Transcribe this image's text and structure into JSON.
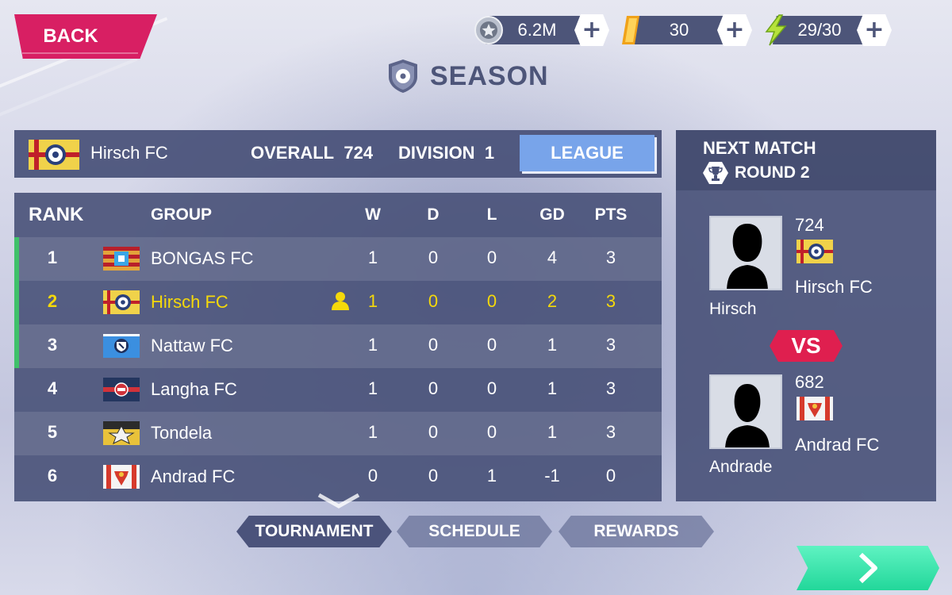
{
  "header": {
    "back_label": "BACK",
    "title": "SEASON",
    "currencies": [
      {
        "icon": "silver-coin-icon",
        "value": "6.2M"
      },
      {
        "icon": "gold-bar-icon",
        "value": "30"
      },
      {
        "icon": "lightning-energy-icon",
        "value": "29/30"
      }
    ],
    "plus_label": "+"
  },
  "team": {
    "name": "Hirsch FC",
    "overall_label": "OVERALL",
    "overall_value": "724",
    "division_label": "DIVISION",
    "division_value": "1",
    "league_button": "LEAGUE"
  },
  "standings": {
    "columns": [
      "RANK",
      "GROUP",
      "W",
      "D",
      "L",
      "GD",
      "PTS"
    ],
    "rows": [
      {
        "rank": "1",
        "name": "BONGAS FC",
        "w": "1",
        "d": "0",
        "l": "0",
        "gd": "4",
        "pts": "3"
      },
      {
        "rank": "2",
        "name": "Hirsch FC",
        "w": "1",
        "d": "0",
        "l": "0",
        "gd": "2",
        "pts": "3"
      },
      {
        "rank": "3",
        "name": "Nattaw FC",
        "w": "1",
        "d": "0",
        "l": "0",
        "gd": "1",
        "pts": "3"
      },
      {
        "rank": "4",
        "name": "Langha FC",
        "w": "1",
        "d": "0",
        "l": "0",
        "gd": "1",
        "pts": "3"
      },
      {
        "rank": "5",
        "name": "Tondela",
        "w": "1",
        "d": "0",
        "l": "0",
        "gd": "1",
        "pts": "3"
      },
      {
        "rank": "6",
        "name": "Andrad FC",
        "w": "0",
        "d": "0",
        "l": "1",
        "gd": "-1",
        "pts": "0"
      }
    ]
  },
  "next_match": {
    "title": "NEXT MATCH",
    "round": "ROUND 2",
    "home": {
      "overall": "724",
      "club": "Hirsch FC",
      "player": "Hirsch"
    },
    "vs": "VS",
    "away": {
      "overall": "682",
      "club": "Andrad FC",
      "player": "Andrade"
    }
  },
  "tabs": [
    "TOURNAMENT",
    "SCHEDULE",
    "REWARDS"
  ],
  "colors": {
    "panel": "#485178",
    "accent_pink": "#d81f63",
    "league_blue": "#78a4ea",
    "highlight_yellow": "#f5d90a",
    "promo_green": "#3fc16a",
    "next_green": "#22d79a"
  }
}
